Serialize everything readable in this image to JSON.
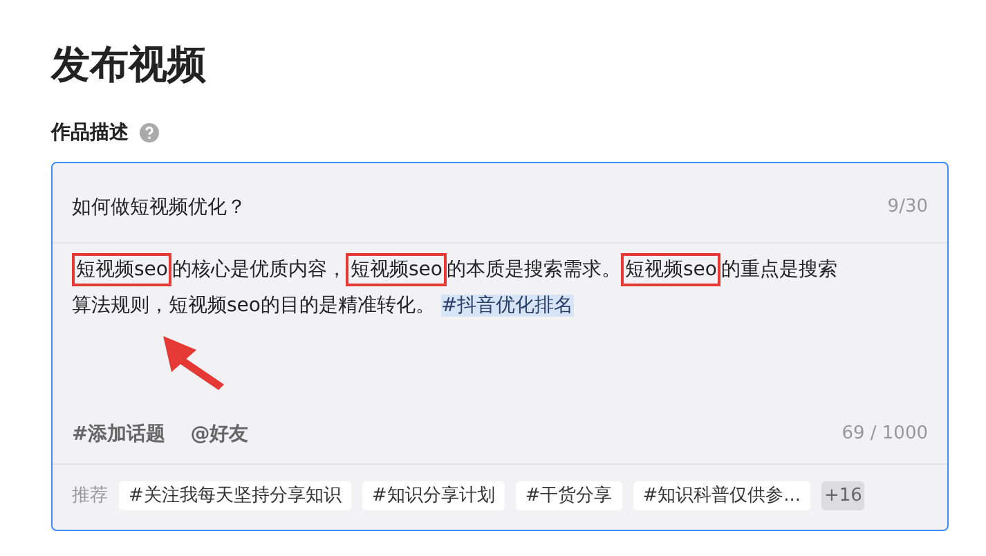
{
  "page_title": "发布视频",
  "description_field": {
    "label": "作品描述",
    "title": {
      "value": "如何做短视频优化？",
      "counter": "9/30"
    },
    "body": [
      {
        "text": "短视频seo",
        "kind": "boxed"
      },
      {
        "text": "的核心是优质内容，",
        "kind": "plain"
      },
      {
        "text": "短视频seo",
        "kind": "boxed"
      },
      {
        "text": "的本质是搜索需求。",
        "kind": "plain"
      },
      {
        "text": "短视频seo",
        "kind": "boxed"
      },
      {
        "text": "的重点是搜索",
        "kind": "plain"
      },
      {
        "text": "算法规则，短视频seo的目的是精准转化。",
        "kind": "plain"
      },
      {
        "text": "#抖音优化排名",
        "kind": "topic"
      }
    ],
    "actions": [
      "#添加话题",
      "@好友"
    ],
    "counter": "69 / 1000"
  },
  "recommend": {
    "label": "推荐",
    "tags": [
      "#关注我每天坚持分享知识",
      "#知识分享计划",
      "#干货分享",
      "#知识科普仅供参..."
    ],
    "more": "+16"
  }
}
